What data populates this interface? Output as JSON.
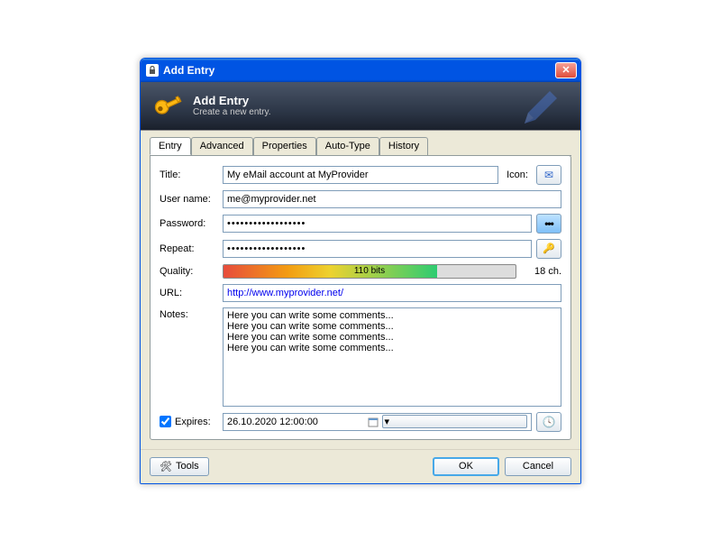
{
  "window": {
    "title": "Add Entry"
  },
  "header": {
    "title": "Add Entry",
    "subtitle": "Create a new entry."
  },
  "tabs": [
    "Entry",
    "Advanced",
    "Properties",
    "Auto-Type",
    "History"
  ],
  "active_tab": 0,
  "fields": {
    "title_label": "Title:",
    "title_value": "My eMail account at MyProvider",
    "icon_label": "Icon:",
    "username_label": "User name:",
    "username_value": "me@myprovider.net",
    "password_label": "Password:",
    "password_value": "••••••••••••••••••",
    "repeat_label": "Repeat:",
    "repeat_value": "••••••••••••••••••",
    "quality_label": "Quality:",
    "quality_text": "110 bits",
    "char_count": "18 ch.",
    "url_label": "URL:",
    "url_value": "http://www.myprovider.net/",
    "notes_label": "Notes:",
    "notes_value": "Here you can write some comments...\nHere you can write some comments...\nHere you can write some comments...\nHere you can write some comments...",
    "expires_label": "Expires:",
    "expires_value": "26.10.2020 12:00:00",
    "expires_checked": true
  },
  "footer": {
    "tools": "Tools",
    "ok": "OK",
    "cancel": "Cancel"
  },
  "icons": {
    "reveal": "•••",
    "generate": "🔑",
    "mail": "✉",
    "clock": "🕓",
    "tools": "🛠"
  }
}
